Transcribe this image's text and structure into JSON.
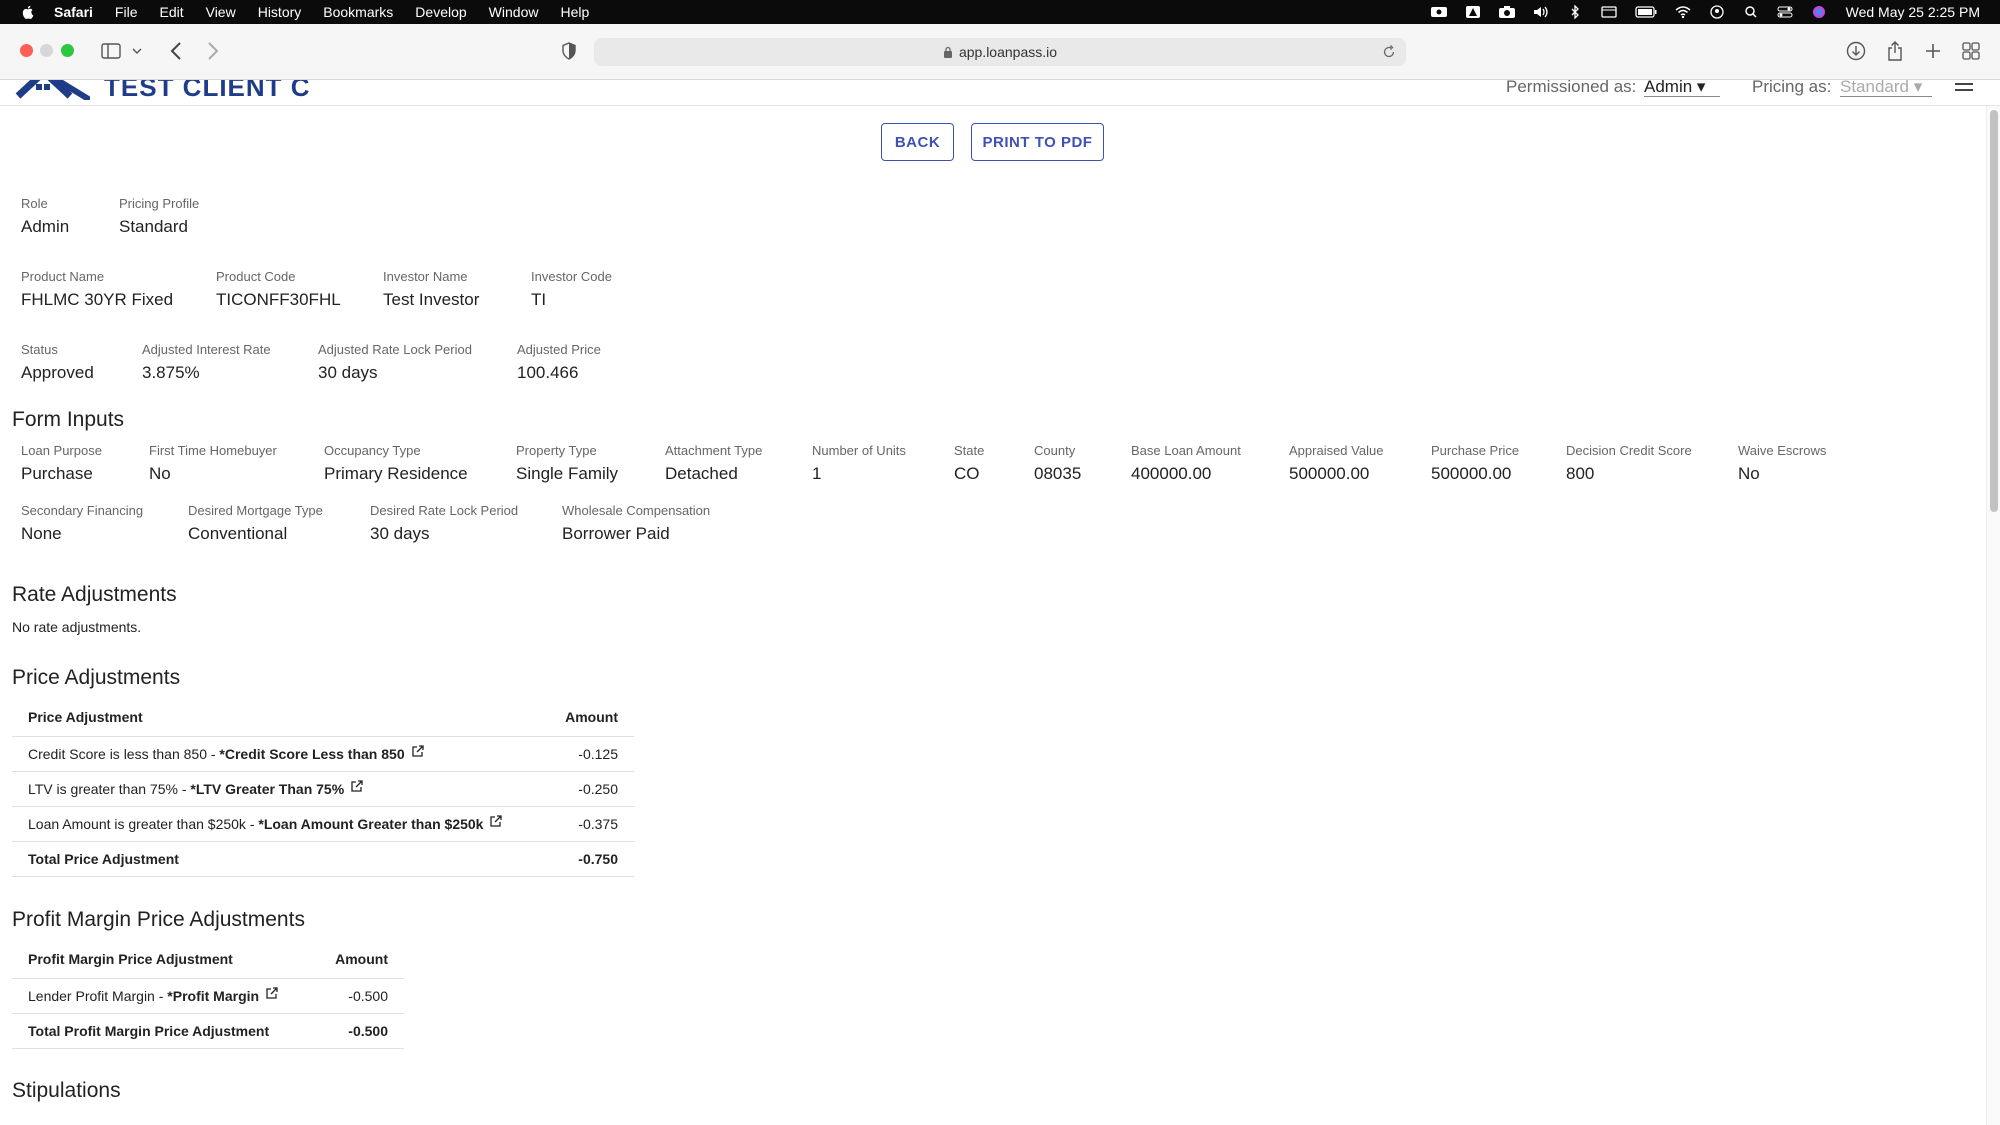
{
  "menubar": {
    "app": "Safari",
    "items": [
      "File",
      "Edit",
      "View",
      "History",
      "Bookmarks",
      "Develop",
      "Window",
      "Help"
    ],
    "clock": "Wed May 25  2:25 PM"
  },
  "browser": {
    "url": "app.loanpass.io"
  },
  "header": {
    "client_name": "TEST CLIENT C",
    "permissioned_label": "Permissioned as:",
    "permissioned_value": "Admin",
    "pricing_label": "Pricing as:",
    "pricing_value": "Standard"
  },
  "actions": {
    "back": "BACK",
    "print": "PRINT TO PDF"
  },
  "summary": {
    "role": {
      "label": "Role",
      "value": "Admin"
    },
    "pricing_profile": {
      "label": "Pricing Profile",
      "value": "Standard"
    },
    "product_name": {
      "label": "Product Name",
      "value": "FHLMC 30YR Fixed"
    },
    "product_code": {
      "label": "Product Code",
      "value": "TICONFF30FHL"
    },
    "investor_name": {
      "label": "Investor Name",
      "value": "Test Investor"
    },
    "investor_code": {
      "label": "Investor Code",
      "value": "TI"
    },
    "status": {
      "label": "Status",
      "value": "Approved"
    },
    "adj_rate": {
      "label": "Adjusted Interest Rate",
      "value": "3.875%"
    },
    "adj_lock": {
      "label": "Adjusted Rate Lock Period",
      "value": "30 days"
    },
    "adj_price": {
      "label": "Adjusted Price",
      "value": "100.466"
    }
  },
  "form_inputs": {
    "title": "Form Inputs",
    "fields": [
      {
        "label": "Loan Purpose",
        "value": "Purchase"
      },
      {
        "label": "First Time Homebuyer",
        "value": "No"
      },
      {
        "label": "Occupancy Type",
        "value": "Primary Residence"
      },
      {
        "label": "Property Type",
        "value": "Single Family"
      },
      {
        "label": "Attachment Type",
        "value": "Detached"
      },
      {
        "label": "Number of Units",
        "value": "1"
      },
      {
        "label": "State",
        "value": "CO"
      },
      {
        "label": "County",
        "value": "08035"
      },
      {
        "label": "Base Loan Amount",
        "value": "400000.00"
      },
      {
        "label": "Appraised Value",
        "value": "500000.00"
      },
      {
        "label": "Purchase Price",
        "value": "500000.00"
      },
      {
        "label": "Decision Credit Score",
        "value": "800"
      },
      {
        "label": "Waive Escrows",
        "value": "No"
      },
      {
        "label": "Secondary Financing",
        "value": "None"
      },
      {
        "label": "Desired Mortgage Type",
        "value": "Conventional"
      },
      {
        "label": "Desired Rate Lock Period",
        "value": "30 days"
      },
      {
        "label": "Wholesale Compensation",
        "value": "Borrower Paid"
      }
    ]
  },
  "rate_adjustments": {
    "title": "Rate Adjustments",
    "empty": "No rate adjustments."
  },
  "price_adjustments": {
    "title": "Price Adjustments",
    "col_name": "Price Adjustment",
    "col_amount": "Amount",
    "rows": [
      {
        "desc": "Credit Score is less than 850 - ",
        "rule": "*Credit Score Less than 850",
        "amount": "-0.125"
      },
      {
        "desc": "LTV is greater than 75% - ",
        "rule": "*LTV Greater Than 75%",
        "amount": "-0.250"
      },
      {
        "desc": "Loan Amount is greater than $250k - ",
        "rule": "*Loan Amount Greater than $250k",
        "amount": "-0.375"
      }
    ],
    "total_label": "Total Price Adjustment",
    "total": "-0.750"
  },
  "profit_margin": {
    "title": "Profit Margin Price Adjustments",
    "col_name": "Profit Margin Price Adjustment",
    "col_amount": "Amount",
    "rows": [
      {
        "desc": "Lender Profit Margin - ",
        "rule": "*Profit Margin",
        "amount": "-0.500"
      }
    ],
    "total_label": "Total Profit Margin Price Adjustment",
    "total": "-0.500"
  },
  "stipulations": {
    "title": "Stipulations"
  }
}
